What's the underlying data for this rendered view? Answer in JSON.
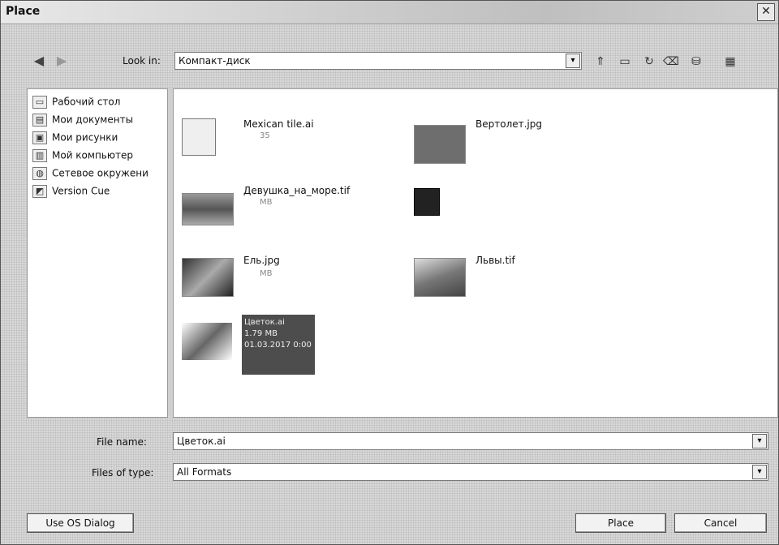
{
  "window": {
    "title": "Place",
    "close_label": "✕"
  },
  "toolbar": {
    "back_icon": "back-arrow-icon",
    "forward_icon": "forward-arrow-icon",
    "lookin_label": "Look in:",
    "lookin_value": "Компакт-диск",
    "lookin_arrow": "▾",
    "icons": [
      "up-folder-icon",
      "new-folder-icon",
      "refresh-icon",
      "delete-icon",
      "drive-menu-icon",
      "view-menu-icon"
    ]
  },
  "places": {
    "items": [
      {
        "label": "Рабочий стол",
        "icon": "desktop-icon"
      },
      {
        "label": "Мои документы",
        "icon": "documents-icon"
      },
      {
        "label": "Мои рисунки",
        "icon": "pictures-icon"
      },
      {
        "label": "Мой компьютер",
        "icon": "computer-icon"
      },
      {
        "label": "Сетевое окружени",
        "icon": "network-icon"
      },
      {
        "label": "Version Cue",
        "icon": "version-cue-icon"
      }
    ]
  },
  "files": [
    {
      "name": "Mexican tile.ai",
      "sub": "35",
      "thumb": "ai-file-icon"
    },
    {
      "name": "Вертолет.jpg",
      "sub": "",
      "thumb": "photo-thumb"
    },
    {
      "name": "Девушка_на_море.tif",
      "sub": "MB",
      "thumb": "photo-thumb"
    },
    {
      "name": "",
      "sub": "",
      "thumb": "photoshop-file-icon"
    },
    {
      "name": "Ель.jpg",
      "sub": "MB",
      "thumb": "photo-thumb"
    },
    {
      "name": "Львы.tif",
      "sub": "",
      "thumb": "photo-thumb"
    },
    {
      "name": "Цветок.ai",
      "sub": "",
      "thumb": "flower-thumb"
    }
  ],
  "selected": {
    "line1": "Цветок.ai",
    "line2": "1.79 MB",
    "line3": "",
    "line4": "01.03.2017 0:00"
  },
  "form": {
    "filename_label": "File name:",
    "filename_value": "Цветок.ai",
    "filetype_label": "Files of type:",
    "filetype_value": "All Formats",
    "arrow": "▾"
  },
  "buttons": {
    "os_dialog": "Use OS Dialog",
    "place": "Place",
    "cancel": "Cancel"
  },
  "colors": {
    "selection": "#4d4d4d"
  }
}
